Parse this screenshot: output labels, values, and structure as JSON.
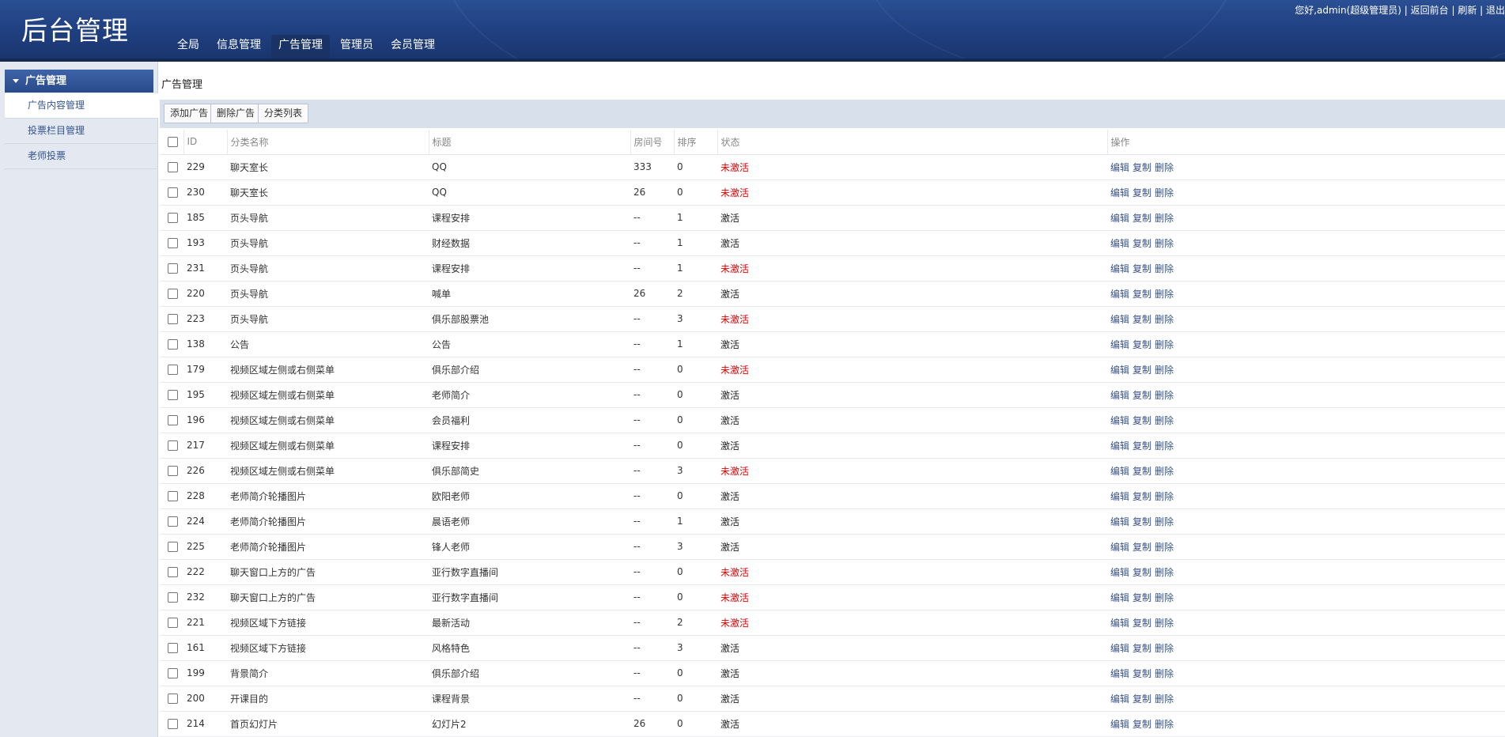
{
  "header": {
    "logo": "后台管理",
    "nav": [
      "全局",
      "信息管理",
      "广告管理",
      "管理员",
      "会员管理"
    ],
    "active_nav": "广告管理",
    "user_text": "您好,admin(超级管理员) | 返回前台 | 刷新 | 退出"
  },
  "sidebar": {
    "title": "广告管理",
    "items": [
      {
        "label": "广告内容管理",
        "active": true
      },
      {
        "label": "投票栏目管理",
        "active": false
      },
      {
        "label": "老师投票",
        "active": false
      }
    ]
  },
  "main": {
    "breadcrumb": "广告管理",
    "toolbar": {
      "add_label": "添加广告",
      "delete_label": "删除广告",
      "category_label": "分类列表"
    },
    "table": {
      "columns": [
        "ID",
        "分类名称",
        "标题",
        "房间号",
        "排序",
        "状态",
        "操作"
      ],
      "actions": [
        "编辑",
        "复制",
        "删除"
      ],
      "rows": [
        {
          "id": "229",
          "category": "聊天室长",
          "title": "QQ",
          "room": "333",
          "sort": "0",
          "status": "未激活"
        },
        {
          "id": "230",
          "category": "聊天室长",
          "title": "QQ",
          "room": "26",
          "sort": "0",
          "status": "未激活"
        },
        {
          "id": "185",
          "category": "页头导航",
          "title": "课程安排",
          "room": "--",
          "sort": "1",
          "status": "激活"
        },
        {
          "id": "193",
          "category": "页头导航",
          "title": "财经数据",
          "room": "--",
          "sort": "1",
          "status": "激活"
        },
        {
          "id": "231",
          "category": "页头导航",
          "title": "课程安排",
          "room": "--",
          "sort": "1",
          "status": "未激活"
        },
        {
          "id": "220",
          "category": "页头导航",
          "title": "喊单",
          "room": "26",
          "sort": "2",
          "status": "激活"
        },
        {
          "id": "223",
          "category": "页头导航",
          "title": "俱乐部股票池",
          "room": "--",
          "sort": "3",
          "status": "未激活"
        },
        {
          "id": "138",
          "category": "公告",
          "title": "公告",
          "room": "--",
          "sort": "1",
          "status": "激活"
        },
        {
          "id": "179",
          "category": "视频区域左侧或右侧菜单",
          "title": "俱乐部介绍",
          "room": "--",
          "sort": "0",
          "status": "未激活"
        },
        {
          "id": "195",
          "category": "视频区域左侧或右侧菜单",
          "title": "老师简介",
          "room": "--",
          "sort": "0",
          "status": "激活"
        },
        {
          "id": "196",
          "category": "视频区域左侧或右侧菜单",
          "title": "会员福利",
          "room": "--",
          "sort": "0",
          "status": "激活"
        },
        {
          "id": "217",
          "category": "视频区域左侧或右侧菜单",
          "title": "课程安排",
          "room": "--",
          "sort": "0",
          "status": "激活"
        },
        {
          "id": "226",
          "category": "视频区域左侧或右侧菜单",
          "title": "俱乐部简史",
          "room": "--",
          "sort": "3",
          "status": "未激活"
        },
        {
          "id": "228",
          "category": "老师简介轮播图片",
          "title": "欧阳老师",
          "room": "--",
          "sort": "0",
          "status": "激活"
        },
        {
          "id": "224",
          "category": "老师简介轮播图片",
          "title": "晨语老师",
          "room": "--",
          "sort": "1",
          "status": "激活"
        },
        {
          "id": "225",
          "category": "老师简介轮播图片",
          "title": "锋人老师",
          "room": "--",
          "sort": "3",
          "status": "激活"
        },
        {
          "id": "222",
          "category": "聊天窗口上方的广告",
          "title": "亚行数字直播间",
          "room": "--",
          "sort": "0",
          "status": "未激活"
        },
        {
          "id": "232",
          "category": "聊天窗口上方的广告",
          "title": "亚行数字直播间",
          "room": "--",
          "sort": "0",
          "status": "未激活"
        },
        {
          "id": "221",
          "category": "视频区域下方链接",
          "title": "最新活动",
          "room": "--",
          "sort": "2",
          "status": "未激活"
        },
        {
          "id": "161",
          "category": "视频区域下方链接",
          "title": "风格特色",
          "room": "--",
          "sort": "3",
          "status": "激活"
        },
        {
          "id": "199",
          "category": "背景简介",
          "title": "俱乐部介绍",
          "room": "--",
          "sort": "0",
          "status": "激活"
        },
        {
          "id": "200",
          "category": "开课目的",
          "title": "课程背景",
          "room": "--",
          "sort": "0",
          "status": "激活"
        },
        {
          "id": "214",
          "category": "首页幻灯片",
          "title": "幻灯片2",
          "room": "26",
          "sort": "0",
          "status": "激活"
        }
      ]
    }
  },
  "colors": {
    "header_bg": "#1f3f7f",
    "sidebar_bg": "#e3e8f1",
    "link": "#35538f",
    "inactive": "#e60000"
  }
}
